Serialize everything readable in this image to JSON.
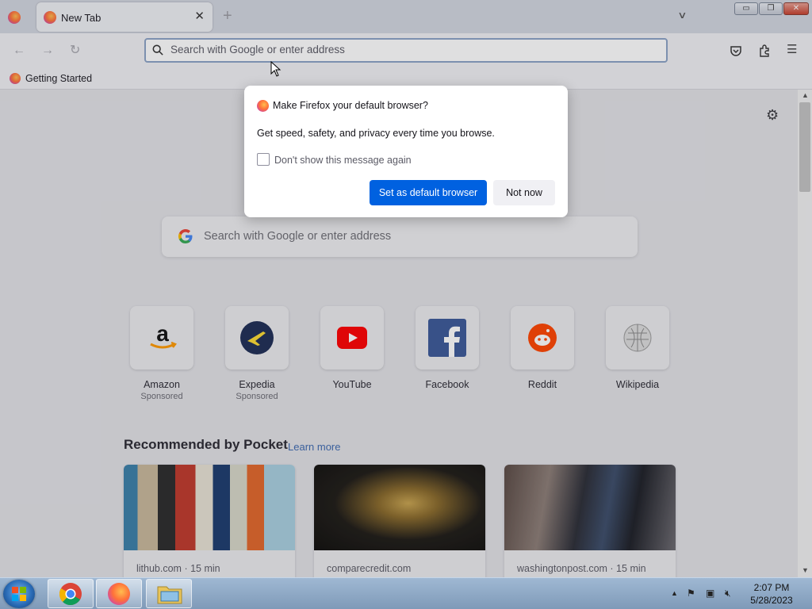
{
  "browser": {
    "tab": {
      "title": "New Tab",
      "close": "✕"
    },
    "new_tab": "+",
    "tab_list": "∨",
    "window_controls": {
      "minimize": "▭",
      "restore": "❐",
      "close": "✕"
    },
    "nav": {
      "back": "←",
      "forward": "→",
      "reload": "↻"
    },
    "urlbar": {
      "placeholder": "Search with Google or enter address"
    },
    "toolbar_icons": {
      "pocket": "pocket-icon",
      "extensions": "puzzle-icon",
      "menu": "☰"
    },
    "bookmarks": [
      {
        "label": "Getting Started"
      }
    ]
  },
  "newtab": {
    "search_placeholder": "Search with Google or enter address",
    "top_sites": [
      {
        "name": "Amazon",
        "sponsor": "Sponsored"
      },
      {
        "name": "Expedia",
        "sponsor": "Sponsored"
      },
      {
        "name": "YouTube",
        "sponsor": ""
      },
      {
        "name": "Facebook",
        "sponsor": ""
      },
      {
        "name": "Reddit",
        "sponsor": ""
      },
      {
        "name": "Wikipedia",
        "sponsor": ""
      }
    ],
    "pocket": {
      "title": "Recommended by Pocket",
      "learn_more": "Learn more",
      "cards": [
        {
          "source": "lithub.com · 15 min"
        },
        {
          "source": "comparecredit.com"
        },
        {
          "source": "washingtonpost.com · 15 min"
        }
      ]
    }
  },
  "dialog": {
    "title": "Make Firefox your default browser?",
    "body": "Get speed, safety, and privacy every time you browse.",
    "checkbox_label": "Don't show this message again",
    "checkbox_checked": false,
    "primary_button": "Set as default browser",
    "secondary_button": "Not now"
  },
  "taskbar": {
    "clock_time": "2:07 PM",
    "clock_date": "5/28/2023"
  },
  "colors": {
    "accent": "#0061e0",
    "urlbar_border": "#8ba3c6"
  }
}
